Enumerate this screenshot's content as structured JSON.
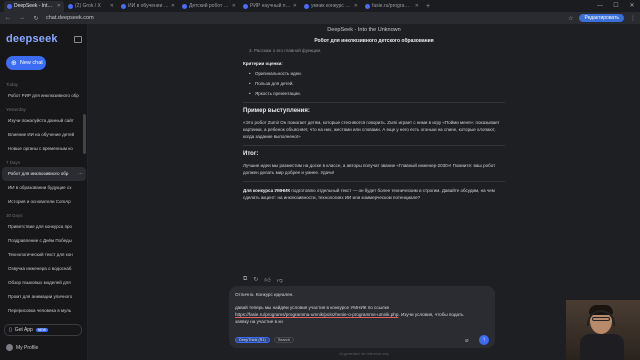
{
  "browser": {
    "tabs": [
      {
        "label": "DeepSeek - Into the Unknown",
        "active": true
      },
      {
        "label": "(2) Grok / X",
        "active": false
      },
      {
        "label": "ИИ в обучении детей",
        "active": false
      },
      {
        "label": "Детский робот - Искусственный",
        "active": false
      },
      {
        "label": "РИР научный проект до",
        "active": false
      },
      {
        "label": "умник конкурс условия",
        "active": false
      },
      {
        "label": "fasie.ru/programs/progr",
        "active": false
      }
    ],
    "url": "chat.deepseek.com",
    "extension_button": "Редактировать"
  },
  "sidebar": {
    "logo": "deepseek",
    "new_chat": "New chat",
    "groups": [
      {
        "label": "Today",
        "items": [
          "Робот РИР для инклюзивного обр"
        ]
      },
      {
        "label": "Yesterday",
        "items": [
          "Изучи пожалуйста данный сайт",
          "Влияние ИИ на обучение детей",
          "Новые органы с временным ко"
        ]
      },
      {
        "label": "7 Days",
        "items": [
          "Робот для инклюзивного обр",
          "ИИ в образовании будущие сх",
          "История и основатели ComAp"
        ]
      },
      {
        "label": "30 Days",
        "items": [
          "Приветствие для конкурса про",
          "Поздравление с Днём Победы",
          "Технологический текст для кон",
          "Озвучка инженера о водоснаб",
          "Обзор языковых моделей для",
          "Промт для анимации уличного",
          "Перерисовка человека в муль"
        ]
      }
    ],
    "active_item": "Робот для инклюзивного обр",
    "get_app": "Get App",
    "get_app_badge": "NEW",
    "profile": "My Profile"
  },
  "main": {
    "chat_title": "DeepSeek - Into the Unknown",
    "doc_title": "Робот для инклюзивного детского образования",
    "faded_line": "3. Расскаж о его главной функции.",
    "criteria_title": "Критерии оценки:",
    "criteria": [
      "Оригинальность идеи.",
      "Польза для детей.",
      "Яркость презентации."
    ],
    "example_title": "Пример выступления:",
    "example_text": "«Это робот Zumi! Он помогает детям, которые стесняются говорить. Zumi играет с ними в игру «Пойми меня»: показывает картинки, а ребенок объясняет, что на них, жестами или словами. А еще у него есть огоньки на спине, которые хлопают, когда задание выполнено!»",
    "result_title": "Итог:",
    "result_text": "Лучшие идеи мы разместим на доске в классе, а авторы получат звание «Главный инженер-2030»! Помните: ваш робот должен делать мир добрее и умнее. Удачи!",
    "umnik_lead": "Для конкурса УМНИК",
    "umnik_text": " подготовлю отдельный текст — он будет более техническим и строгим. Давайте обсудим, на чем сделать акцент: на инклюзивности, технологиях ИИ или коммерческом потенциале?",
    "input_text_1": "Отлично. Конкурс идеален.",
    "input_text_2": "давай теперь мы найдём условия участия в конкурсе УМНИК по ссылке ",
    "input_link": "https://fasie.ru/programs/programma-umnik/polozhenie-o-programme-umnik.php",
    "input_text_3": ". Изучи условия, чтобы подать заявку на участие в кн",
    "tool_deepthink": "DeepThink (R1)",
    "tool_search": "Search",
    "disclaimer": "AI-generated, for reference only"
  }
}
